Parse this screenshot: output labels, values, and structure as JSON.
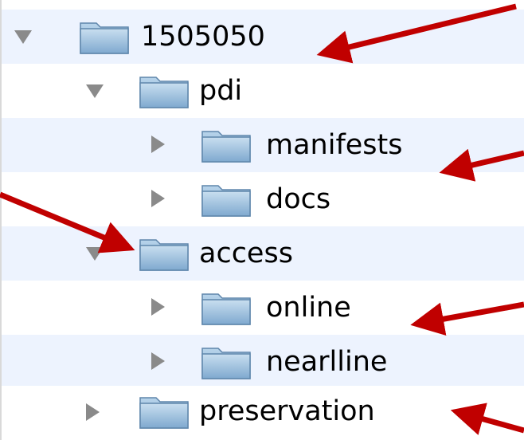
{
  "tree": {
    "items": [
      {
        "label": "1505050",
        "icon": "folder-icon",
        "expanded": true
      },
      {
        "label": "pdi",
        "icon": "folder-icon",
        "expanded": true
      },
      {
        "label": "manifests",
        "icon": "folder-icon",
        "expanded": false
      },
      {
        "label": "docs",
        "icon": "folder-icon",
        "expanded": false
      },
      {
        "label": "access",
        "icon": "folder-icon",
        "expanded": true
      },
      {
        "label": "online",
        "icon": "folder-icon",
        "expanded": false
      },
      {
        "label": "nearlline",
        "icon": "folder-icon",
        "expanded": false
      },
      {
        "label": "preservation",
        "icon": "folder-icon",
        "expanded": false
      }
    ]
  },
  "colors": {
    "row_alt": "#edf3fe",
    "annotation_arrow": "#c00000",
    "disclosure_triangle": "#8a8a8a",
    "folder_fill": "#9fc2df"
  }
}
